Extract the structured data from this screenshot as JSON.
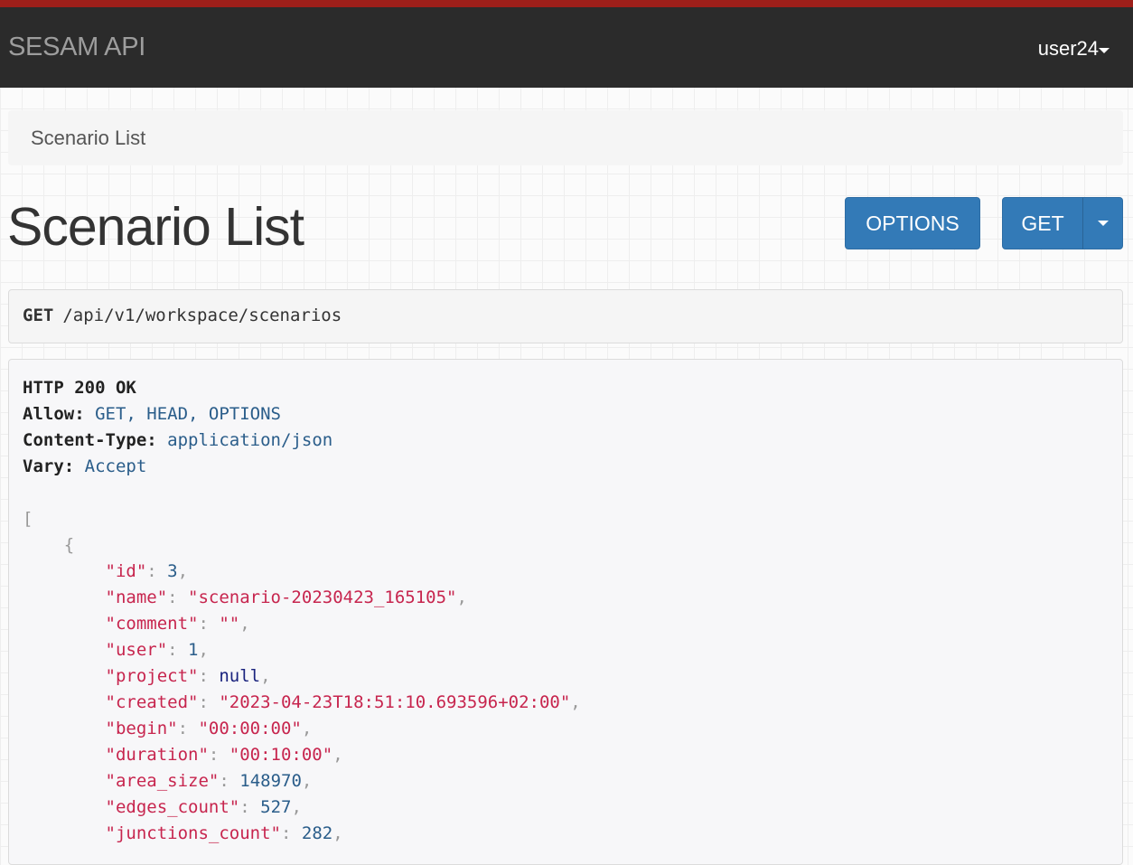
{
  "navbar": {
    "brand": "SESAM API",
    "user": "user24"
  },
  "breadcrumb": {
    "items": [
      "Scenario List"
    ]
  },
  "page": {
    "title": "Scenario List"
  },
  "buttons": {
    "options": "OPTIONS",
    "get": "GET"
  },
  "request": {
    "method": "GET",
    "path": "/api/v1/workspace/scenarios"
  },
  "response": {
    "status": "HTTP 200 OK",
    "headers": [
      {
        "name": "Allow:",
        "value": "GET, HEAD, OPTIONS"
      },
      {
        "name": "Content-Type:",
        "value": "application/json"
      },
      {
        "name": "Vary:",
        "value": "Accept"
      }
    ],
    "open_bracket": "[",
    "open_brace": "{",
    "fields": [
      {
        "key": "\"id\"",
        "value": "3",
        "kind": "num"
      },
      {
        "key": "\"name\"",
        "value": "\"scenario-20230423_165105\"",
        "kind": "str"
      },
      {
        "key": "\"comment\"",
        "value": "\"\"",
        "kind": "str"
      },
      {
        "key": "\"user\"",
        "value": "1",
        "kind": "num"
      },
      {
        "key": "\"project\"",
        "value": "null",
        "kind": "lit"
      },
      {
        "key": "\"created\"",
        "value": "\"2023-04-23T18:51:10.693596+02:00\"",
        "kind": "str"
      },
      {
        "key": "\"begin\"",
        "value": "\"00:00:00\"",
        "kind": "str"
      },
      {
        "key": "\"duration\"",
        "value": "\"00:10:00\"",
        "kind": "str"
      },
      {
        "key": "\"area_size\"",
        "value": "148970",
        "kind": "num"
      },
      {
        "key": "\"edges_count\"",
        "value": "527",
        "kind": "num"
      },
      {
        "key": "\"junctions_count\"",
        "value": "282",
        "kind": "num"
      }
    ]
  },
  "colors": {
    "stripe": "#9e1f1a",
    "navbar": "#2b2b2b",
    "primary": "#337ab7",
    "json_key": "#c7254e",
    "json_number": "#2a5d8a",
    "json_literal": "#1a237e"
  },
  "icons": {
    "user_menu": "caret-down-icon",
    "get_dropdown": "caret-down-icon"
  }
}
